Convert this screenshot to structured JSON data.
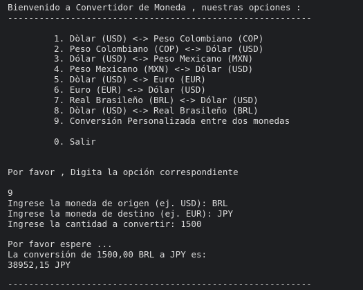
{
  "terminal": {
    "header": "Bienvenido a Convertidor de Moneda , nuestras opciones :",
    "separator": "----------------------------------------------------------",
    "menu": [
      "1. Dòlar (USD) <-> Peso Colombiano (COP)",
      "2. Peso Colombiano (COP) <-> Dólar (USD)",
      "3. Dólar (USD) <-> Peso Mexicano (MXN)",
      "4. Peso Mexicano (MXN) <-> Dólar (USD)",
      "5. Dòlar (USD) <-> Euro (EUR)",
      "6. Euro (EUR) <-> Dólar (USD)",
      "7. Real Brasileño (BRL) <-> Dólar (USD)",
      "8. Dòlar (USD) <-> Real Brasileño (BRL)",
      "9. Conversión Personalizada entre dos monedas"
    ],
    "exit_option": "0. Salir",
    "prompt": "Por favor , Digita la opción correspondiente",
    "user_choice": "9",
    "origin_prompt": "Ingrese la moneda de origen (ej. USD): BRL",
    "destination_prompt": "Ingrese la moneda de destino (ej. EUR): JPY",
    "amount_prompt": "Ingrese la cantidad a convertir: 1500",
    "wait_message": "Por favor espere ...",
    "result_label": "La conversión de 1500,00 BRL a JPY es:",
    "result_value": "38952,15 JPY",
    "bottom_separator": "----------------------------------------------------------"
  }
}
